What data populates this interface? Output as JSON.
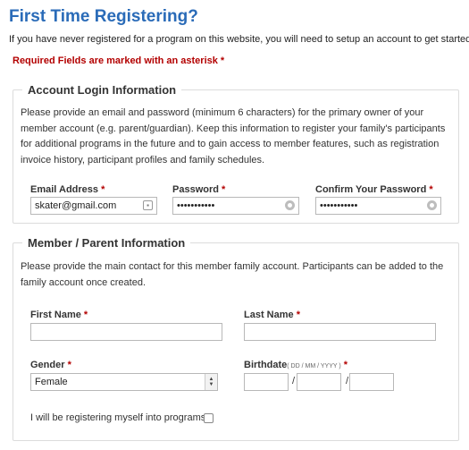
{
  "page": {
    "title": "First Time Registering?",
    "intro": "If you have never registered for a program on this website, you will need to setup an account to get started.",
    "required_note": "Required Fields are marked with an asterisk *"
  },
  "account_section": {
    "legend": "Account Login Information",
    "description": "Please provide an email and password (minimum 6 characters) for the primary owner of your member account (e.g. parent/guardian). Keep this information to register your family's participants for additional programs in the future and to gain access to member features, such as registration invoice history, participant profiles and family schedules.",
    "email": {
      "label": "Email Address",
      "value": "skater@gmail.com",
      "icon": "contact-card-icon"
    },
    "password": {
      "label": "Password",
      "value": "•••••••••••",
      "icon": "key-icon"
    },
    "confirm_password": {
      "label": "Confirm Your Password",
      "value": "•••••••••••",
      "icon": "key-icon"
    }
  },
  "member_section": {
    "legend": "Member / Parent Information",
    "description": "Please provide the main contact for this member family account. Participants can be added to the family account once created.",
    "first_name": {
      "label": "First Name",
      "value": ""
    },
    "last_name": {
      "label": "Last Name",
      "value": ""
    },
    "gender": {
      "label": "Gender",
      "selected": "Female"
    },
    "birthdate": {
      "label": "Birthdate",
      "hint": "( DD / MM / YYYY )",
      "separator": "/"
    },
    "self_register": {
      "label": "I will be registering myself into programs",
      "checked": false
    }
  },
  "required_marker": "*",
  "colors": {
    "title": "#2a6bb8",
    "required": "#b30000",
    "border": "#dcdcdc"
  }
}
